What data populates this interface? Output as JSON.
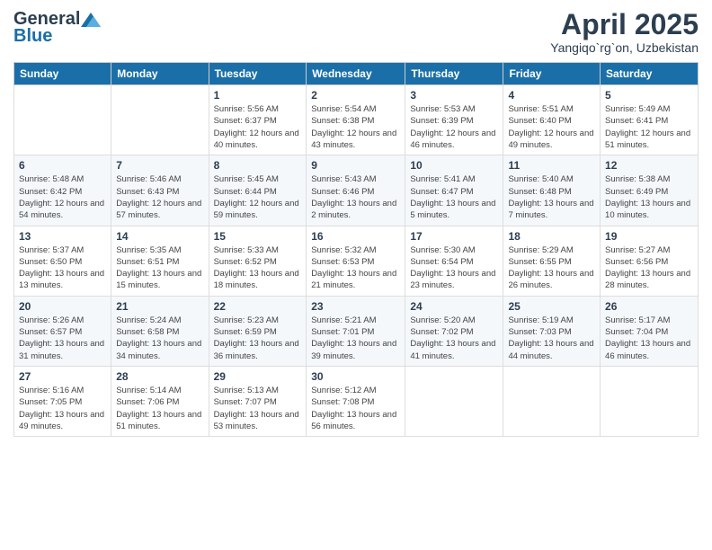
{
  "header": {
    "logo_general": "General",
    "logo_blue": "Blue",
    "title": "April 2025",
    "location": "Yangiqo`rg`on, Uzbekistan"
  },
  "days_of_week": [
    "Sunday",
    "Monday",
    "Tuesday",
    "Wednesday",
    "Thursday",
    "Friday",
    "Saturday"
  ],
  "weeks": [
    [
      {
        "day": "",
        "info": ""
      },
      {
        "day": "",
        "info": ""
      },
      {
        "day": "1",
        "info": "Sunrise: 5:56 AM\nSunset: 6:37 PM\nDaylight: 12 hours and 40 minutes."
      },
      {
        "day": "2",
        "info": "Sunrise: 5:54 AM\nSunset: 6:38 PM\nDaylight: 12 hours and 43 minutes."
      },
      {
        "day": "3",
        "info": "Sunrise: 5:53 AM\nSunset: 6:39 PM\nDaylight: 12 hours and 46 minutes."
      },
      {
        "day": "4",
        "info": "Sunrise: 5:51 AM\nSunset: 6:40 PM\nDaylight: 12 hours and 49 minutes."
      },
      {
        "day": "5",
        "info": "Sunrise: 5:49 AM\nSunset: 6:41 PM\nDaylight: 12 hours and 51 minutes."
      }
    ],
    [
      {
        "day": "6",
        "info": "Sunrise: 5:48 AM\nSunset: 6:42 PM\nDaylight: 12 hours and 54 minutes."
      },
      {
        "day": "7",
        "info": "Sunrise: 5:46 AM\nSunset: 6:43 PM\nDaylight: 12 hours and 57 minutes."
      },
      {
        "day": "8",
        "info": "Sunrise: 5:45 AM\nSunset: 6:44 PM\nDaylight: 12 hours and 59 minutes."
      },
      {
        "day": "9",
        "info": "Sunrise: 5:43 AM\nSunset: 6:46 PM\nDaylight: 13 hours and 2 minutes."
      },
      {
        "day": "10",
        "info": "Sunrise: 5:41 AM\nSunset: 6:47 PM\nDaylight: 13 hours and 5 minutes."
      },
      {
        "day": "11",
        "info": "Sunrise: 5:40 AM\nSunset: 6:48 PM\nDaylight: 13 hours and 7 minutes."
      },
      {
        "day": "12",
        "info": "Sunrise: 5:38 AM\nSunset: 6:49 PM\nDaylight: 13 hours and 10 minutes."
      }
    ],
    [
      {
        "day": "13",
        "info": "Sunrise: 5:37 AM\nSunset: 6:50 PM\nDaylight: 13 hours and 13 minutes."
      },
      {
        "day": "14",
        "info": "Sunrise: 5:35 AM\nSunset: 6:51 PM\nDaylight: 13 hours and 15 minutes."
      },
      {
        "day": "15",
        "info": "Sunrise: 5:33 AM\nSunset: 6:52 PM\nDaylight: 13 hours and 18 minutes."
      },
      {
        "day": "16",
        "info": "Sunrise: 5:32 AM\nSunset: 6:53 PM\nDaylight: 13 hours and 21 minutes."
      },
      {
        "day": "17",
        "info": "Sunrise: 5:30 AM\nSunset: 6:54 PM\nDaylight: 13 hours and 23 minutes."
      },
      {
        "day": "18",
        "info": "Sunrise: 5:29 AM\nSunset: 6:55 PM\nDaylight: 13 hours and 26 minutes."
      },
      {
        "day": "19",
        "info": "Sunrise: 5:27 AM\nSunset: 6:56 PM\nDaylight: 13 hours and 28 minutes."
      }
    ],
    [
      {
        "day": "20",
        "info": "Sunrise: 5:26 AM\nSunset: 6:57 PM\nDaylight: 13 hours and 31 minutes."
      },
      {
        "day": "21",
        "info": "Sunrise: 5:24 AM\nSunset: 6:58 PM\nDaylight: 13 hours and 34 minutes."
      },
      {
        "day": "22",
        "info": "Sunrise: 5:23 AM\nSunset: 6:59 PM\nDaylight: 13 hours and 36 minutes."
      },
      {
        "day": "23",
        "info": "Sunrise: 5:21 AM\nSunset: 7:01 PM\nDaylight: 13 hours and 39 minutes."
      },
      {
        "day": "24",
        "info": "Sunrise: 5:20 AM\nSunset: 7:02 PM\nDaylight: 13 hours and 41 minutes."
      },
      {
        "day": "25",
        "info": "Sunrise: 5:19 AM\nSunset: 7:03 PM\nDaylight: 13 hours and 44 minutes."
      },
      {
        "day": "26",
        "info": "Sunrise: 5:17 AM\nSunset: 7:04 PM\nDaylight: 13 hours and 46 minutes."
      }
    ],
    [
      {
        "day": "27",
        "info": "Sunrise: 5:16 AM\nSunset: 7:05 PM\nDaylight: 13 hours and 49 minutes."
      },
      {
        "day": "28",
        "info": "Sunrise: 5:14 AM\nSunset: 7:06 PM\nDaylight: 13 hours and 51 minutes."
      },
      {
        "day": "29",
        "info": "Sunrise: 5:13 AM\nSunset: 7:07 PM\nDaylight: 13 hours and 53 minutes."
      },
      {
        "day": "30",
        "info": "Sunrise: 5:12 AM\nSunset: 7:08 PM\nDaylight: 13 hours and 56 minutes."
      },
      {
        "day": "",
        "info": ""
      },
      {
        "day": "",
        "info": ""
      },
      {
        "day": "",
        "info": ""
      }
    ]
  ]
}
